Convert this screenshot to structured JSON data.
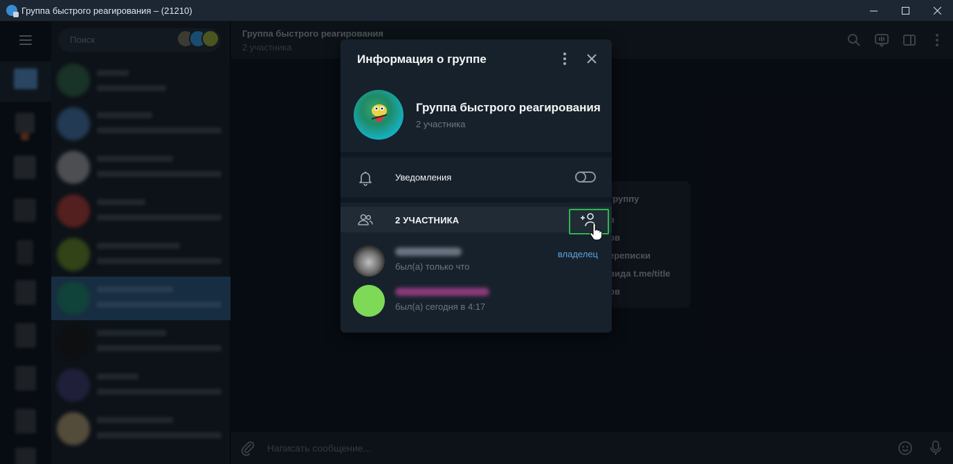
{
  "window": {
    "title": "Группа быстрого реагирования – (21210)",
    "minimize": "—",
    "maximize": "☐",
    "close": "✕"
  },
  "sidebar": {
    "search_placeholder": "Поиск"
  },
  "chat": {
    "title": "Группа быстрого реагирования",
    "subtitle": "2 участника",
    "service_lines": [
      "группу",
      "в",
      "ов",
      "ереписки",
      "вида t.me/title",
      "ов"
    ],
    "composer_placeholder": "Написать сообщение..."
  },
  "modal": {
    "title": "Информация о группе",
    "group_name": "Группа быстрого реагирования",
    "group_members": "2 участника",
    "notifications_label": "Уведомления",
    "notifications_on": false,
    "members_header": "2 УЧАСТНИКА",
    "members": [
      {
        "status": "был(а) только что",
        "role": "владелец"
      },
      {
        "status": "был(а) сегодня в 4:17",
        "role": ""
      }
    ]
  },
  "colors": {
    "accent": "#5aa4e0",
    "highlight_box": "#2fb94a",
    "panel": "#17212b",
    "background": "#0e1621"
  },
  "icons": [
    "menu-icon",
    "search-icon",
    "more-icon",
    "close-icon",
    "bell-icon",
    "members-icon",
    "add-user-icon",
    "attach-icon",
    "emoji-icon",
    "mic-icon",
    "side-panel-icon",
    "voice-chat-icon"
  ]
}
